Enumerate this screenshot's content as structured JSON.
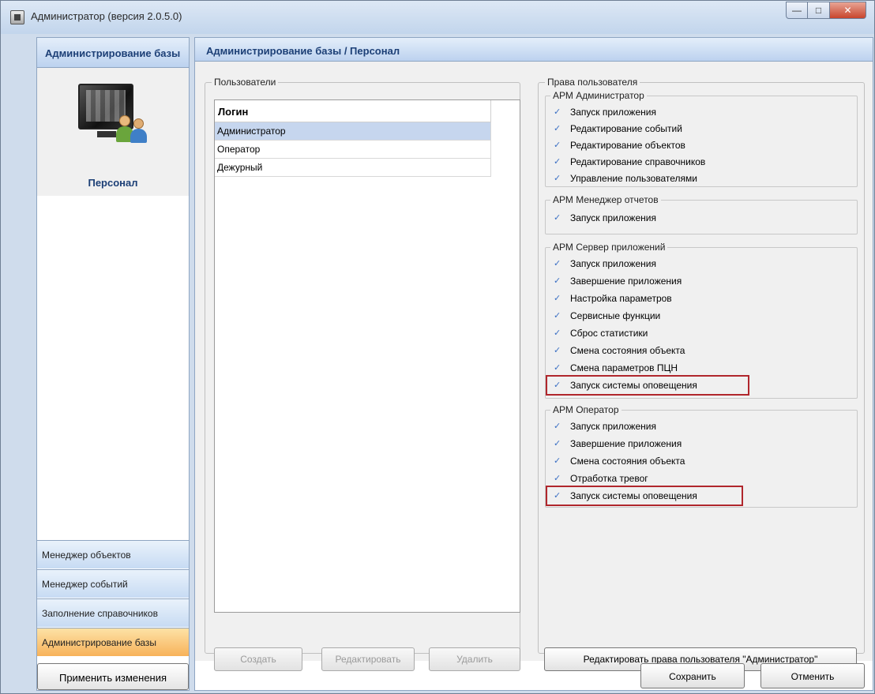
{
  "window": {
    "title": "Администратор (версия 2.0.5.0)"
  },
  "nav": {
    "header": "Администрирование базы",
    "tile_label": "Персонал",
    "items": [
      {
        "label": "Менеджер объектов"
      },
      {
        "label": "Менеджер событий"
      },
      {
        "label": "Заполнение справочников"
      },
      {
        "label": "Администрирование базы"
      }
    ],
    "apply_label": "Применить изменения"
  },
  "main": {
    "header": "Администрирование базы / Персонал",
    "users": {
      "group_label": "Пользователи",
      "column": "Логин",
      "rows": [
        "Администратор",
        "Оператор",
        "Дежурный"
      ],
      "buttons": {
        "create": "Создать",
        "edit": "Редактировать",
        "delete": "Удалить"
      }
    },
    "rights": {
      "group_label": "Права пользователя",
      "groups": [
        {
          "label": "АРМ Администратор",
          "items": [
            "Запуск приложения",
            "Редактирование событий",
            "Редактирование объектов",
            "Редактирование справочников",
            "Управление пользователями"
          ]
        },
        {
          "label": "АРМ Менеджер отчетов",
          "items": [
            "Запуск приложения"
          ]
        },
        {
          "label": "АРМ Сервер приложений",
          "items": [
            "Запуск приложения",
            "Завершение приложения",
            "Настройка параметров",
            "Сервисные функции",
            "Сброс статистики",
            "Смена состояния объекта",
            "Смена параметров ПЦН",
            "Запуск системы оповещения"
          ]
        },
        {
          "label": "АРМ Оператор",
          "items": [
            "Запуск приложения",
            "Завершение приложения",
            "Смена состояния объекта",
            "Отработка тревог",
            "Запуск системы оповещения"
          ]
        }
      ],
      "edit_button": "Редактировать права пользователя \"Администратор\""
    },
    "footer": {
      "save": "Сохранить",
      "cancel": "Отменить"
    }
  },
  "colors": {
    "highlight": "#b0262c",
    "nav_active": "#f7b25a",
    "selection": "#c6d6ee"
  }
}
